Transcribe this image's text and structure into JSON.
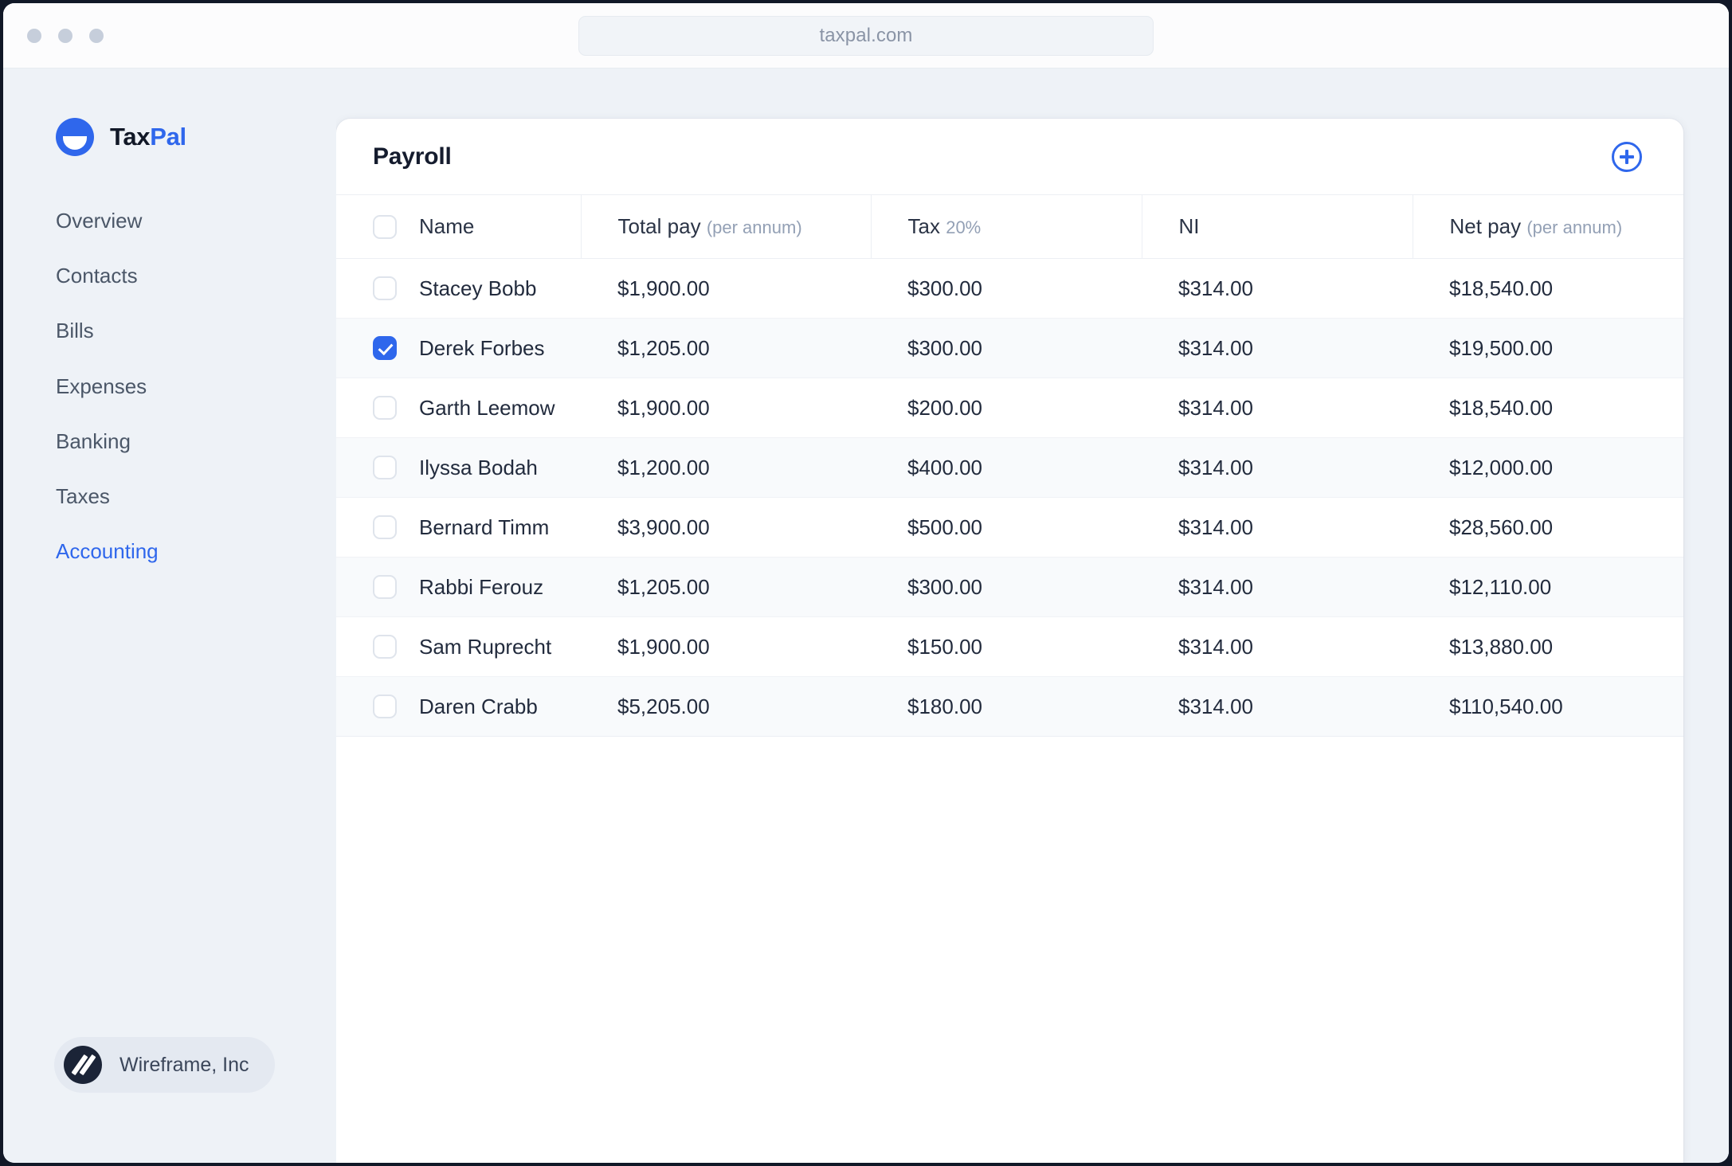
{
  "browser": {
    "url": "taxpal.com",
    "dots": [
      "dot-1",
      "dot-2",
      "dot-3"
    ]
  },
  "sidebar": {
    "brand": {
      "name_part1": "Tax",
      "name_part2": "Pal",
      "logo_icon": "taxpal-logo-icon"
    },
    "items": [
      {
        "label": "Overview",
        "active": false
      },
      {
        "label": "Contacts",
        "active": false
      },
      {
        "label": "Bills",
        "active": false
      },
      {
        "label": "Expenses",
        "active": false
      },
      {
        "label": "Banking",
        "active": false
      },
      {
        "label": "Taxes",
        "active": false
      },
      {
        "label": "Accounting",
        "active": true
      }
    ],
    "org": {
      "name": "Wireframe, Inc",
      "logo_icon": "wireframe-logo-icon"
    }
  },
  "card": {
    "title": "Payroll",
    "add_button_icon": "plus-circle-icon",
    "columns": [
      {
        "key": "name",
        "label": "Name",
        "sub": ""
      },
      {
        "key": "total_pay",
        "label": "Total pay",
        "sub": "(per annum)"
      },
      {
        "key": "tax",
        "label": "Tax",
        "sub": "20%"
      },
      {
        "key": "ni",
        "label": "NI",
        "sub": ""
      },
      {
        "key": "net_pay",
        "label": "Net pay",
        "sub": "(per annum)"
      }
    ],
    "select_all_checked": false,
    "rows": [
      {
        "selected": false,
        "name": "Stacey Bobb",
        "total_pay": "$1,900.00",
        "tax": "$300.00",
        "ni": "$314.00",
        "net_pay": "$18,540.00"
      },
      {
        "selected": true,
        "name": "Derek Forbes",
        "total_pay": "$1,205.00",
        "tax": "$300.00",
        "ni": "$314.00",
        "net_pay": "$19,500.00"
      },
      {
        "selected": false,
        "name": "Garth Leemow",
        "total_pay": "$1,900.00",
        "tax": "$200.00",
        "ni": "$314.00",
        "net_pay": "$18,540.00"
      },
      {
        "selected": false,
        "name": "Ilyssa Bodah",
        "total_pay": "$1,200.00",
        "tax": "$400.00",
        "ni": "$314.00",
        "net_pay": "$12,000.00"
      },
      {
        "selected": false,
        "name": "Bernard Timm",
        "total_pay": "$3,900.00",
        "tax": "$500.00",
        "ni": "$314.00",
        "net_pay": "$28,560.00"
      },
      {
        "selected": false,
        "name": "Rabbi Ferouz",
        "total_pay": "$1,205.00",
        "tax": "$300.00",
        "ni": "$314.00",
        "net_pay": "$12,110.00"
      },
      {
        "selected": false,
        "name": "Sam Ruprecht",
        "total_pay": "$1,900.00",
        "tax": "$150.00",
        "ni": "$314.00",
        "net_pay": "$13,880.00"
      },
      {
        "selected": false,
        "name": "Daren Crabb",
        "total_pay": "$5,205.00",
        "tax": "$180.00",
        "ni": "$314.00",
        "net_pay": "$110,540.00"
      }
    ]
  },
  "colors": {
    "accent": "#2f67ec",
    "page_bg": "#eef2f7",
    "card_bg": "#ffffff",
    "row_alt_bg": "#f8fafc",
    "text": "#222b3d",
    "muted": "#93a0b5",
    "org_mark": "#1b2437"
  }
}
